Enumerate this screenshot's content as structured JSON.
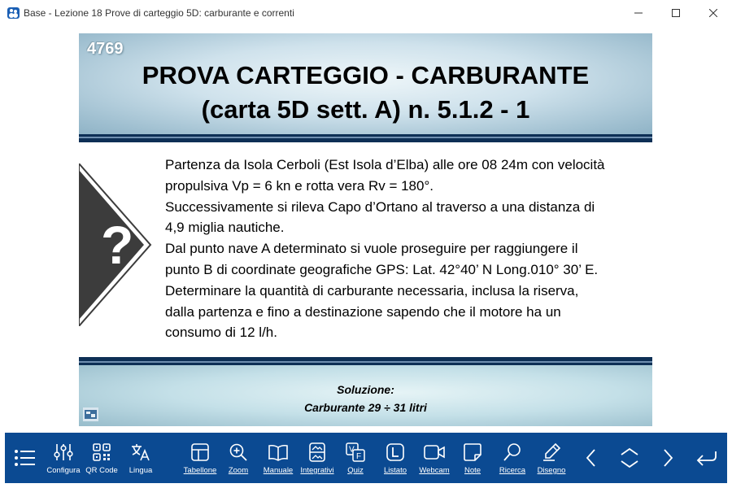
{
  "window": {
    "title": "Base - Lezione 18 Prove di carteggio 5D: carburante e correnti"
  },
  "slide": {
    "number": "4769",
    "title_line1": "PROVA CARTEGGIO - CARBURANTE",
    "title_line2": "(carta 5D sett. A) n. 5.1.2 - 1",
    "question_mark": "?",
    "problem_lines": [
      "Partenza da Isola Cerboli (Est Isola d’Elba) alle ore 08 24m con velocità",
      "propulsiva Vp = 6 kn e rotta vera Rv = 180°.",
      "Successivamente si rileva Capo d’Ortano al traverso a una distanza di",
      "4,9 miglia nautiche.",
      "Dal punto nave A determinato si vuole proseguire per raggiungere il",
      "punto B di coordinate geografiche GPS: Lat. 42°40’ N  Long.010° 30’ E.",
      "Determinare la quantità di carburante necessaria, inclusa la riserva,",
      "dalla partenza e fino a destinazione sapendo che il motore ha un",
      "consumo di 12 l/h."
    ],
    "solution_label": "Soluzione:",
    "solution_value": "Carburante 29 ÷ 31 litri"
  },
  "toolbar": {
    "menu_icon": "list-icon",
    "items": [
      {
        "label": "Configura",
        "icon": "sliders-icon"
      },
      {
        "label": "QR Code",
        "icon": "qr-code-icon"
      },
      {
        "label": "Lingua",
        "icon": "translate-icon"
      },
      {
        "label": "Tabellone",
        "icon": "grid-icon"
      },
      {
        "label": "Zoom",
        "icon": "zoom-in-icon"
      },
      {
        "label": "Manuale",
        "icon": "book-icon"
      },
      {
        "label": "Integrativi",
        "icon": "image-stack-icon"
      },
      {
        "label": "Quiz",
        "icon": "quiz-icon"
      },
      {
        "label": "Listato",
        "icon": "listato-icon"
      },
      {
        "label": "Webcam",
        "icon": "webcam-icon"
      },
      {
        "label": "Note",
        "icon": "note-icon"
      },
      {
        "label": "Ricerca",
        "icon": "search-icon"
      },
      {
        "label": "Disegno",
        "icon": "pen-icon"
      }
    ],
    "nav": [
      "chevron-left-icon",
      "collapse-icon",
      "chevron-right-icon",
      "return-icon"
    ]
  },
  "colors": {
    "toolbar_bg": "#0b4a92",
    "band": "#0d2f55",
    "question_diamond": "#3c3c3c"
  }
}
